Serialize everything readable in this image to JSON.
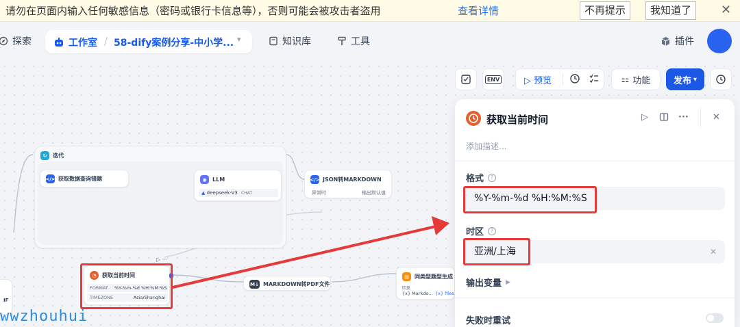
{
  "banner": {
    "message": "请勿在页面内输入任何敏感信息（密码或银行卡信息等），否则可能会被攻击者盗用",
    "link": "查看详情",
    "no_remind": "不再提示",
    "got_it": "我知道了",
    "close": "✕"
  },
  "nav": {
    "explore": "探索",
    "studio": "工作室",
    "app_name": "58-dify案例分享-中小学...",
    "knowledge": "知识库",
    "tools": "工具",
    "plugins": "插件"
  },
  "toolbar": {
    "env": "ENV",
    "preview": "预览",
    "features": "功能",
    "publish": "发布"
  },
  "nodes": {
    "iteration": "迭代",
    "fetch_question": "获取数据查询错题",
    "llm": "LLM",
    "llm_model": "deepseek-V3",
    "llm_mode": "CHAT",
    "json2md": "JSON转MARKDOWN",
    "json2md_left": "异常时",
    "json2md_right": "输出默认值",
    "time_node": "获取当前时间",
    "format_key": "FORMAT",
    "format_val": "%Y-%m-%d %H:%M:%S",
    "tz_key": "TIMEZONE",
    "tz_val": "Asia/Shanghai",
    "md2pdf": "MARKDOWN转PDF文件",
    "similar_gen": "同类型题型生成",
    "similar_line1": "回复",
    "similar_var": "{x} Markdo...",
    "similar_files": "{x} files",
    "if_label": "IF"
  },
  "panel": {
    "title": "获取当前时间",
    "add_desc": "添加描述...",
    "format_label": "格式",
    "format_value": "%Y-%m-%d %H:%M:%S",
    "timezone_label": "时区",
    "timezone_value": "亚洲/上海",
    "output_vars": "输出变量",
    "retry_on_fail": "失败时重试"
  },
  "watermark": "wwzhouhui",
  "colors": {
    "accent": "#155aef",
    "highlight": "#e5393a",
    "time_icon": "#e35f2f"
  }
}
